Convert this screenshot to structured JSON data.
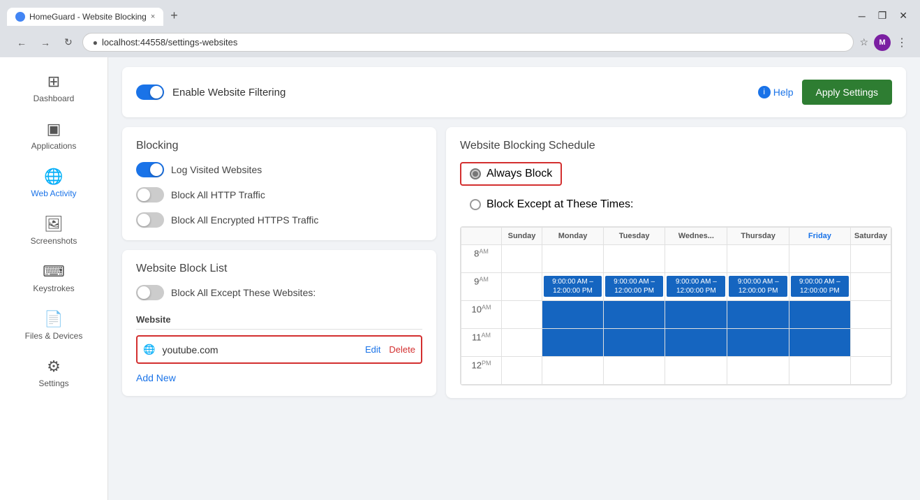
{
  "browser": {
    "tab_title": "HomeGuard - Website Blocking",
    "url": "localhost:44558/settings-websites",
    "tab_close": "×",
    "new_tab": "+",
    "win_minimize": "─",
    "win_maximize": "❐",
    "win_close": "✕",
    "profile_initial": "M"
  },
  "sidebar": {
    "items": [
      {
        "id": "dashboard",
        "label": "Dashboard",
        "icon": "⊞"
      },
      {
        "id": "applications",
        "label": "Applications",
        "icon": "▣"
      },
      {
        "id": "web-activity",
        "label": "Web Activity",
        "icon": "🌐"
      },
      {
        "id": "screenshots",
        "label": "Screenshots",
        "icon": "🖼"
      },
      {
        "id": "keystrokes",
        "label": "Keystrokes",
        "icon": "⌨"
      },
      {
        "id": "files-devices",
        "label": "Files & Devices",
        "icon": "📄"
      },
      {
        "id": "settings",
        "label": "Settings",
        "icon": "⚙"
      }
    ]
  },
  "top_bar": {
    "enable_label": "Enable Website Filtering",
    "help_label": "Help",
    "apply_label": "Apply Settings"
  },
  "blocking": {
    "section_title": "Blocking",
    "log_visited_label": "Log Visited Websites",
    "block_http_label": "Block All HTTP Traffic",
    "block_https_label": "Block All Encrypted HTTPS Traffic"
  },
  "block_list": {
    "section_title": "Website Block List",
    "block_all_except_label": "Block All Except These Websites:",
    "column_header": "Website",
    "entries": [
      {
        "url": "youtube.com",
        "edit": "Edit",
        "delete": "Delete"
      }
    ],
    "add_new_label": "Add New"
  },
  "schedule": {
    "section_title": "Website Blocking Schedule",
    "always_block_label": "Always Block",
    "block_except_label": "Block Except at These Times:",
    "days": [
      "",
      "Sunday",
      "Monday",
      "Tuesday",
      "Wednes...",
      "Thursday",
      "Friday",
      "Saturday"
    ],
    "time_slots": [
      {
        "time": "8",
        "ampm": "AM",
        "events": [
          false,
          false,
          false,
          false,
          false,
          false,
          false
        ]
      },
      {
        "time": "9",
        "ampm": "AM",
        "events": [
          false,
          true,
          true,
          true,
          true,
          true,
          false
        ]
      },
      {
        "time": "10",
        "ampm": "AM",
        "events": [
          false,
          true,
          true,
          true,
          true,
          true,
          false
        ]
      },
      {
        "time": "11",
        "ampm": "AM",
        "events": [
          false,
          true,
          true,
          true,
          true,
          true,
          false
        ]
      },
      {
        "time": "12",
        "ampm": "PM",
        "events": [
          false,
          false,
          false,
          false,
          false,
          false,
          false
        ]
      }
    ],
    "event_label": "9:00:00 AM – 12:00:00 PM"
  }
}
